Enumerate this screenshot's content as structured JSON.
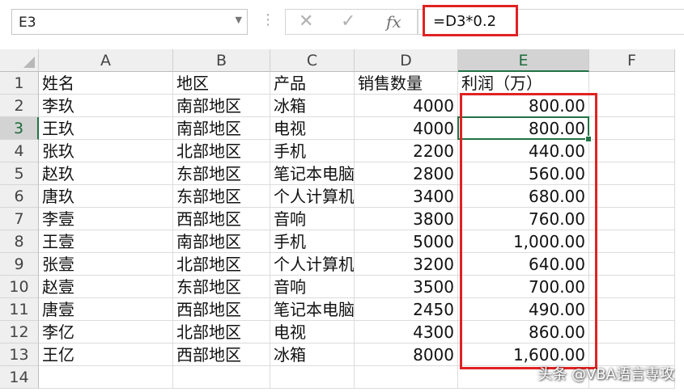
{
  "formula_bar": {
    "name_box": "E3",
    "cancel_icon": "✕",
    "enter_icon": "✓",
    "fx_label": "fx",
    "formula": "=D3*0.2"
  },
  "columns": [
    "A",
    "B",
    "C",
    "D",
    "E",
    "F"
  ],
  "active_cell": "E3",
  "rows": [
    {
      "num": "1",
      "cells": [
        "姓名",
        "地区",
        "产品",
        "销售数量",
        "利润（万）",
        ""
      ]
    },
    {
      "num": "2",
      "cells": [
        "李玖",
        "南部地区",
        "冰箱",
        "4000",
        "800.00",
        ""
      ]
    },
    {
      "num": "3",
      "cells": [
        "王玖",
        "南部地区",
        "电视",
        "4000",
        "800.00",
        ""
      ]
    },
    {
      "num": "4",
      "cells": [
        "张玖",
        "北部地区",
        "手机",
        "2200",
        "440.00",
        ""
      ]
    },
    {
      "num": "5",
      "cells": [
        "赵玖",
        "东部地区",
        "笔记本电脑",
        "2800",
        "560.00",
        ""
      ]
    },
    {
      "num": "6",
      "cells": [
        "唐玖",
        "东部地区",
        "个人计算机",
        "3400",
        "680.00",
        ""
      ]
    },
    {
      "num": "7",
      "cells": [
        "李壹",
        "西部地区",
        "音响",
        "3800",
        "760.00",
        ""
      ]
    },
    {
      "num": "8",
      "cells": [
        "王壹",
        "南部地区",
        "手机",
        "5000",
        "1,000.00",
        ""
      ]
    },
    {
      "num": "9",
      "cells": [
        "张壹",
        "北部地区",
        "个人计算机",
        "3200",
        "640.00",
        ""
      ]
    },
    {
      "num": "10",
      "cells": [
        "赵壹",
        "东部地区",
        "音响",
        "3500",
        "700.00",
        ""
      ]
    },
    {
      "num": "11",
      "cells": [
        "唐壹",
        "西部地区",
        "笔记本电脑",
        "2450",
        "490.00",
        ""
      ]
    },
    {
      "num": "12",
      "cells": [
        "李亿",
        "北部地区",
        "电视",
        "4300",
        "860.00",
        ""
      ]
    },
    {
      "num": "13",
      "cells": [
        "王亿",
        "西部地区",
        "冰箱",
        "8000",
        "1,600.00",
        ""
      ]
    },
    {
      "num": "14",
      "cells": [
        "",
        "",
        "",
        "",
        "",
        ""
      ]
    }
  ],
  "watermark": "头条 @VBA语言専攻",
  "colors": {
    "highlight_red": "#e02222",
    "excel_green": "#217346",
    "header_bg": "#efefef"
  }
}
